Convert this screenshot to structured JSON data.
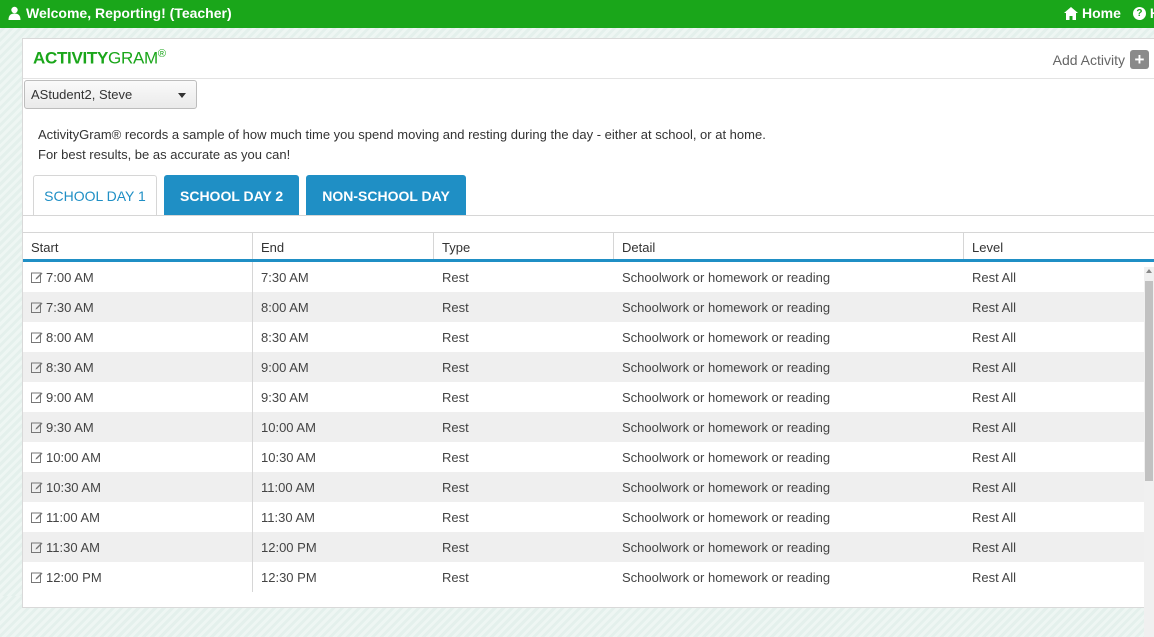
{
  "topbar": {
    "welcome": "Welcome, Reporting! (Teacher)",
    "home_label": "Home",
    "help_label": "H"
  },
  "header": {
    "logo_bold": "ACTIVITY",
    "logo_light": "GRAM",
    "logo_mark": "®",
    "add_activity_label": "Add Activity"
  },
  "student_select": {
    "value": "AStudent2, Steve"
  },
  "intro": {
    "line1": "ActivityGram® records a sample of how much time you spend moving and resting during the day - either at school, or at home.",
    "line2": "For best results, be as accurate as you can!"
  },
  "tabs": [
    {
      "label": "SCHOOL DAY 1",
      "active": true
    },
    {
      "label": "SCHOOL DAY 2",
      "active": false
    },
    {
      "label": "NON-SCHOOL DAY",
      "active": false
    }
  ],
  "table": {
    "columns": [
      "Start",
      "End",
      "Type",
      "Detail",
      "Level"
    ],
    "rows": [
      {
        "start": "7:00 AM",
        "end": "7:30 AM",
        "type": "Rest",
        "detail": "Schoolwork or homework or reading",
        "level": "Rest All"
      },
      {
        "start": "7:30 AM",
        "end": "8:00 AM",
        "type": "Rest",
        "detail": "Schoolwork or homework or reading",
        "level": "Rest All"
      },
      {
        "start": "8:00 AM",
        "end": "8:30 AM",
        "type": "Rest",
        "detail": "Schoolwork or homework or reading",
        "level": "Rest All"
      },
      {
        "start": "8:30 AM",
        "end": "9:00 AM",
        "type": "Rest",
        "detail": "Schoolwork or homework or reading",
        "level": "Rest All"
      },
      {
        "start": "9:00 AM",
        "end": "9:30 AM",
        "type": "Rest",
        "detail": "Schoolwork or homework or reading",
        "level": "Rest All"
      },
      {
        "start": "9:30 AM",
        "end": "10:00 AM",
        "type": "Rest",
        "detail": "Schoolwork or homework or reading",
        "level": "Rest All"
      },
      {
        "start": "10:00 AM",
        "end": "10:30 AM",
        "type": "Rest",
        "detail": "Schoolwork or homework or reading",
        "level": "Rest All"
      },
      {
        "start": "10:30 AM",
        "end": "11:00 AM",
        "type": "Rest",
        "detail": "Schoolwork or homework or reading",
        "level": "Rest All"
      },
      {
        "start": "11:00 AM",
        "end": "11:30 AM",
        "type": "Rest",
        "detail": "Schoolwork or homework or reading",
        "level": "Rest All"
      },
      {
        "start": "11:30 AM",
        "end": "12:00 PM",
        "type": "Rest",
        "detail": "Schoolwork or homework or reading",
        "level": "Rest All"
      },
      {
        "start": "12:00 PM",
        "end": "12:30 PM",
        "type": "Rest",
        "detail": "Schoolwork or homework or reading",
        "level": "Rest All"
      }
    ]
  },
  "colors": {
    "brand_green": "#1aa61a",
    "tab_blue": "#1f8fc5"
  }
}
